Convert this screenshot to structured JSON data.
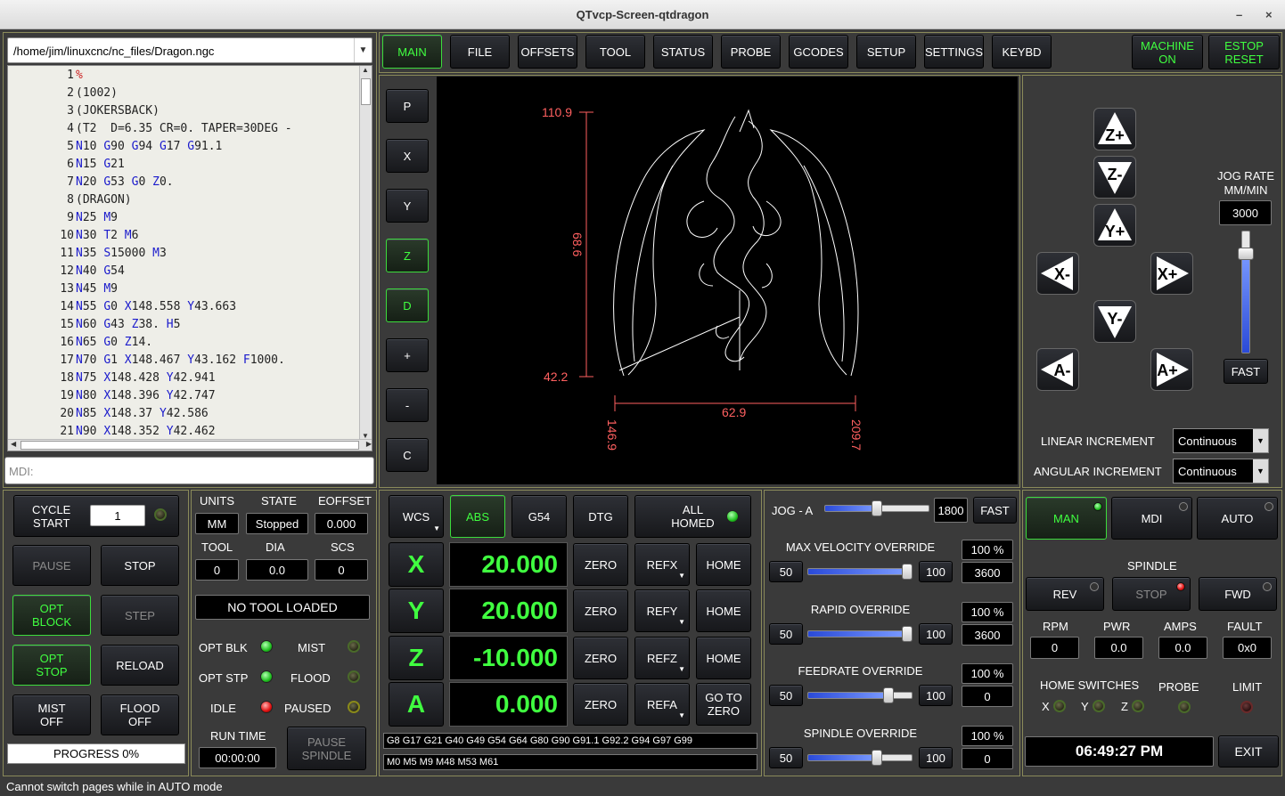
{
  "window": {
    "title": "QTvcp-Screen-qtdragon",
    "min": "–",
    "close": "×"
  },
  "file": {
    "path": "/home/jim/linuxcnc/nc_files/Dragon.ngc",
    "lines": [
      {
        "n": "1",
        "t": [
          {
            "c": "pct",
            "s": "%"
          }
        ]
      },
      {
        "n": "2",
        "t": [
          {
            "c": "",
            "s": "(1002)"
          }
        ]
      },
      {
        "n": "3",
        "t": [
          {
            "c": "",
            "s": "(JOKERSBACK)"
          }
        ]
      },
      {
        "n": "4",
        "t": [
          {
            "c": "",
            "s": "(T2  D=6.35 CR=0. TAPER=30DEG -"
          }
        ]
      },
      {
        "n": "5",
        "t": [
          {
            "c": "kw",
            "s": "N"
          },
          {
            "c": "",
            "s": "10 "
          },
          {
            "c": "kw",
            "s": "G"
          },
          {
            "c": "",
            "s": "90 "
          },
          {
            "c": "kw",
            "s": "G"
          },
          {
            "c": "",
            "s": "94 "
          },
          {
            "c": "kw",
            "s": "G"
          },
          {
            "c": "",
            "s": "17 "
          },
          {
            "c": "kw",
            "s": "G"
          },
          {
            "c": "",
            "s": "91.1"
          }
        ]
      },
      {
        "n": "6",
        "t": [
          {
            "c": "kw",
            "s": "N"
          },
          {
            "c": "",
            "s": "15 "
          },
          {
            "c": "kw",
            "s": "G"
          },
          {
            "c": "",
            "s": "21"
          }
        ]
      },
      {
        "n": "7",
        "t": [
          {
            "c": "kw",
            "s": "N"
          },
          {
            "c": "",
            "s": "20 "
          },
          {
            "c": "kw",
            "s": "G"
          },
          {
            "c": "",
            "s": "53 "
          },
          {
            "c": "kw",
            "s": "G"
          },
          {
            "c": "",
            "s": "0 "
          },
          {
            "c": "kw",
            "s": "Z"
          },
          {
            "c": "",
            "s": "0."
          }
        ]
      },
      {
        "n": "8",
        "t": [
          {
            "c": "",
            "s": "(DRAGON)"
          }
        ]
      },
      {
        "n": "9",
        "t": [
          {
            "c": "kw",
            "s": "N"
          },
          {
            "c": "",
            "s": "25 "
          },
          {
            "c": "kw",
            "s": "M"
          },
          {
            "c": "",
            "s": "9"
          }
        ]
      },
      {
        "n": "10",
        "t": [
          {
            "c": "kw",
            "s": "N"
          },
          {
            "c": "",
            "s": "30 "
          },
          {
            "c": "kw",
            "s": "T"
          },
          {
            "c": "",
            "s": "2 "
          },
          {
            "c": "kw",
            "s": "M"
          },
          {
            "c": "",
            "s": "6"
          }
        ]
      },
      {
        "n": "11",
        "t": [
          {
            "c": "kw",
            "s": "N"
          },
          {
            "c": "",
            "s": "35 "
          },
          {
            "c": "kw",
            "s": "S"
          },
          {
            "c": "",
            "s": "15000 "
          },
          {
            "c": "kw",
            "s": "M"
          },
          {
            "c": "",
            "s": "3"
          }
        ]
      },
      {
        "n": "12",
        "t": [
          {
            "c": "kw",
            "s": "N"
          },
          {
            "c": "",
            "s": "40 "
          },
          {
            "c": "kw",
            "s": "G"
          },
          {
            "c": "",
            "s": "54"
          }
        ]
      },
      {
        "n": "13",
        "t": [
          {
            "c": "kw",
            "s": "N"
          },
          {
            "c": "",
            "s": "45 "
          },
          {
            "c": "kw",
            "s": "M"
          },
          {
            "c": "",
            "s": "9"
          }
        ]
      },
      {
        "n": "14",
        "t": [
          {
            "c": "kw",
            "s": "N"
          },
          {
            "c": "",
            "s": "55 "
          },
          {
            "c": "kw",
            "s": "G"
          },
          {
            "c": "",
            "s": "0 "
          },
          {
            "c": "kw",
            "s": "X"
          },
          {
            "c": "",
            "s": "148.558 "
          },
          {
            "c": "kw",
            "s": "Y"
          },
          {
            "c": "",
            "s": "43.663"
          }
        ]
      },
      {
        "n": "15",
        "t": [
          {
            "c": "kw",
            "s": "N"
          },
          {
            "c": "",
            "s": "60 "
          },
          {
            "c": "kw",
            "s": "G"
          },
          {
            "c": "",
            "s": "43 "
          },
          {
            "c": "kw",
            "s": "Z"
          },
          {
            "c": "",
            "s": "38. "
          },
          {
            "c": "kw",
            "s": "H"
          },
          {
            "c": "",
            "s": "5"
          }
        ]
      },
      {
        "n": "16",
        "t": [
          {
            "c": "kw",
            "s": "N"
          },
          {
            "c": "",
            "s": "65 "
          },
          {
            "c": "kw",
            "s": "G"
          },
          {
            "c": "",
            "s": "0 "
          },
          {
            "c": "kw",
            "s": "Z"
          },
          {
            "c": "",
            "s": "14."
          }
        ]
      },
      {
        "n": "17",
        "t": [
          {
            "c": "kw",
            "s": "N"
          },
          {
            "c": "",
            "s": "70 "
          },
          {
            "c": "kw",
            "s": "G"
          },
          {
            "c": "",
            "s": "1 "
          },
          {
            "c": "kw",
            "s": "X"
          },
          {
            "c": "",
            "s": "148.467 "
          },
          {
            "c": "kw",
            "s": "Y"
          },
          {
            "c": "",
            "s": "43.162 "
          },
          {
            "c": "kw",
            "s": "F"
          },
          {
            "c": "",
            "s": "1000."
          }
        ]
      },
      {
        "n": "18",
        "t": [
          {
            "c": "kw",
            "s": "N"
          },
          {
            "c": "",
            "s": "75 "
          },
          {
            "c": "kw",
            "s": "X"
          },
          {
            "c": "",
            "s": "148.428 "
          },
          {
            "c": "kw",
            "s": "Y"
          },
          {
            "c": "",
            "s": "42.941"
          }
        ]
      },
      {
        "n": "19",
        "t": [
          {
            "c": "kw",
            "s": "N"
          },
          {
            "c": "",
            "s": "80 "
          },
          {
            "c": "kw",
            "s": "X"
          },
          {
            "c": "",
            "s": "148.396 "
          },
          {
            "c": "kw",
            "s": "Y"
          },
          {
            "c": "",
            "s": "42.747"
          }
        ]
      },
      {
        "n": "20",
        "t": [
          {
            "c": "kw",
            "s": "N"
          },
          {
            "c": "",
            "s": "85 "
          },
          {
            "c": "kw",
            "s": "X"
          },
          {
            "c": "",
            "s": "148.37 "
          },
          {
            "c": "kw",
            "s": "Y"
          },
          {
            "c": "",
            "s": "42.586"
          }
        ]
      },
      {
        "n": "21",
        "t": [
          {
            "c": "kw",
            "s": "N"
          },
          {
            "c": "",
            "s": "90 "
          },
          {
            "c": "kw",
            "s": "X"
          },
          {
            "c": "",
            "s": "148.352 "
          },
          {
            "c": "kw",
            "s": "Y"
          },
          {
            "c": "",
            "s": "42.462"
          }
        ]
      }
    ],
    "mdi_placeholder": "MDI:"
  },
  "tabs": [
    "MAIN",
    "FILE",
    "OFFSETS",
    "TOOL",
    "STATUS",
    "PROBE",
    "GCODES",
    "SETUP",
    "SETTINGS",
    "KEYBD"
  ],
  "machine_on": "MACHINE\nON",
  "estop_reset": "ESTOP\nRESET",
  "view_buttons": [
    "P",
    "X",
    "Y",
    "Z",
    "D",
    "+",
    "-",
    "C"
  ],
  "preview": {
    "ymax": "110.9",
    "ymin": "42.2",
    "yspan": "68.6",
    "xmin": "146.9",
    "xmax": "209.7",
    "xspan": "62.9"
  },
  "jog": {
    "z_plus": "Z+",
    "z_minus": "Z-",
    "y_plus": "Y+",
    "y_minus": "Y-",
    "x_minus": "X-",
    "x_plus": "X+",
    "a_minus": "A-",
    "a_plus": "A+",
    "rate_label": "JOG RATE\nMM/MIN",
    "rate": "3000",
    "rate_fraction": 0.85,
    "fast": "FAST",
    "linear_label": "LINEAR INCREMENT",
    "linear_value": "Continuous",
    "angular_label": "ANGULAR INCREMENT",
    "angular_value": "Continuous"
  },
  "left_controls": {
    "cycle_start": "CYCLE\nSTART",
    "cycle_count": "1",
    "pause": "PAUSE",
    "stop": "STOP",
    "opt_block": "OPT\nBLOCK",
    "step": "STEP",
    "opt_stop": "OPT\nSTOP",
    "reload": "RELOAD",
    "mist_off": "MIST\nOFF",
    "flood_off": "FLOOD\nOFF",
    "progress": "PROGRESS 0%"
  },
  "status_block": {
    "units_label": "UNITS",
    "units": "MM",
    "state_label": "STATE",
    "state": "Stopped",
    "eoffset_label": "EOFFSET",
    "eoffset": "0.000",
    "tool_label": "TOOL",
    "tool": "0",
    "dia_label": "DIA",
    "dia": "0.0",
    "scs_label": "SCS",
    "scs": "0",
    "no_tool": "NO TOOL LOADED",
    "opt_blk": "OPT BLK",
    "mist": "MIST",
    "opt_stp": "OPT STP",
    "flood": "FLOOD",
    "idle": "IDLE",
    "paused": "PAUSED",
    "run_time_label": "RUN TIME",
    "run_time": "00:00:00",
    "pause_spindle": "PAUSE\nSPINDLE"
  },
  "dro": {
    "wcs": "WCS",
    "abs": "ABS",
    "g54": "G54",
    "dtg": "DTG",
    "all_homed": "ALL\nHOMED",
    "axes": [
      {
        "name": "X",
        "value": "20.000",
        "ref": "REFX",
        "home": "HOME"
      },
      {
        "name": "Y",
        "value": "20.000",
        "ref": "REFY",
        "home": "HOME"
      },
      {
        "name": "Z",
        "value": "-10.000",
        "ref": "REFZ",
        "home": "HOME"
      },
      {
        "name": "A",
        "value": "0.000",
        "ref": "REFA",
        "home": "GO TO\nZERO"
      }
    ],
    "zero": "ZERO",
    "gcodes": "G8 G17 G21 G40 G49 G54 G64 G80 G90 G91.1 G92.2 G94 G97 G99",
    "mcodes": "M0 M5 M9 M48 M53 M61"
  },
  "overrides": {
    "jog_a_label": "JOG - A",
    "jog_a_value": "1800",
    "jog_a_fraction": 0.5,
    "jog_a_fast": "FAST",
    "items": [
      {
        "label": "MAX VELOCITY OVERRIDE",
        "min": "50",
        "max": "100",
        "pct": "100 %",
        "value": "3600",
        "fraction": 1.0
      },
      {
        "label": "RAPID OVERRIDE",
        "min": "50",
        "max": "100",
        "pct": "100 %",
        "value": "3600",
        "fraction": 1.0
      },
      {
        "label": "FEEDRATE OVERRIDE",
        "min": "50",
        "max": "100",
        "pct": "100 %",
        "value": "0",
        "fraction": 0.8
      },
      {
        "label": "SPINDLE OVERRIDE",
        "min": "50",
        "max": "100",
        "pct": "100 %",
        "value": "0",
        "fraction": 0.68
      }
    ]
  },
  "spindle": {
    "man": "MAN",
    "mdi": "MDI",
    "auto": "AUTO",
    "spindle_label": "SPINDLE",
    "rev": "REV",
    "stop": "STOP",
    "fwd": "FWD",
    "rpm_label": "RPM",
    "rpm": "0",
    "pwr_label": "PWR",
    "pwr": "0.0",
    "amps_label": "AMPS",
    "amps": "0.0",
    "fault_label": "FAULT",
    "fault": "0x0",
    "home_switches": "HOME SWITCHES",
    "x": "X",
    "y": "Y",
    "z": "Z",
    "probe": "PROBE",
    "limit": "LIMIT",
    "clock": "06:49:27 PM",
    "exit": "EXIT"
  },
  "status_bar": "Cannot switch pages while in AUTO mode",
  "colors": {
    "accent_green": "#40ff40",
    "background": "#3a3a3a",
    "plot_dim": "#ff6060"
  }
}
